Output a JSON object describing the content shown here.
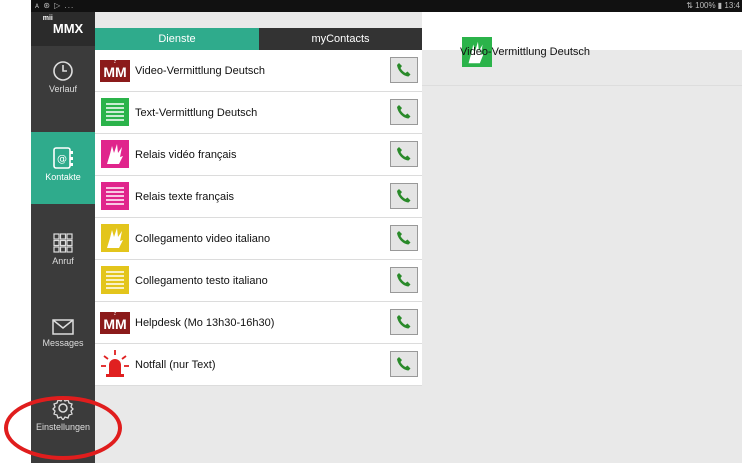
{
  "statusbar": {
    "left": "ᴀ ⊛ ▷ ...",
    "right": "⇅ 100% ▮ 13:4"
  },
  "logo": {
    "sup": "mii",
    "text": "MMX"
  },
  "sidebar": {
    "items": [
      {
        "label": "Verlauf",
        "icon": "clock-icon"
      },
      {
        "label": "Kontakte",
        "icon": "address-book-icon"
      },
      {
        "label": "Anruf",
        "icon": "dialpad-icon"
      },
      {
        "label": "Messages",
        "icon": "envelope-icon"
      },
      {
        "label": "Einstellungen",
        "icon": "gear-icon"
      }
    ]
  },
  "tabs": [
    {
      "label": "Dienste",
      "active": true
    },
    {
      "label": "myContacts",
      "active": false
    }
  ],
  "services": [
    {
      "label": "Video-Vermittlung Deutsch",
      "icon": "mm-logo-icon",
      "color": "#8b1a1a"
    },
    {
      "label": "Text-Vermittlung Deutsch",
      "icon": "text-lines-icon",
      "color": "#2bb34a"
    },
    {
      "label": "Relais vidéo français",
      "icon": "signing-hands-icon",
      "color": "#e0258c"
    },
    {
      "label": "Relais texte français",
      "icon": "text-lines-icon",
      "color": "#e0258c"
    },
    {
      "label": "Collegamento video italiano",
      "icon": "signing-hands-icon",
      "color": "#e3c51c"
    },
    {
      "label": "Collegamento testo italiano",
      "icon": "text-lines-icon",
      "color": "#e3c51c"
    },
    {
      "label": "Helpdesk (Mo 13h30-16h30)",
      "icon": "mm-logo-icon",
      "color": "#8b1a1a"
    },
    {
      "label": "Notfall (nur Text)",
      "icon": "siren-icon",
      "color": "#e02020"
    }
  ],
  "detail": {
    "title": "Video-Vermittlung Deutsch",
    "icon": "signing-hands-icon",
    "color": "#2bb34a"
  },
  "colors": {
    "accent": "#2fab8c",
    "sidebar": "#3b3b3b",
    "call": "#2a8a2a",
    "annotation": "#e01d1d"
  }
}
